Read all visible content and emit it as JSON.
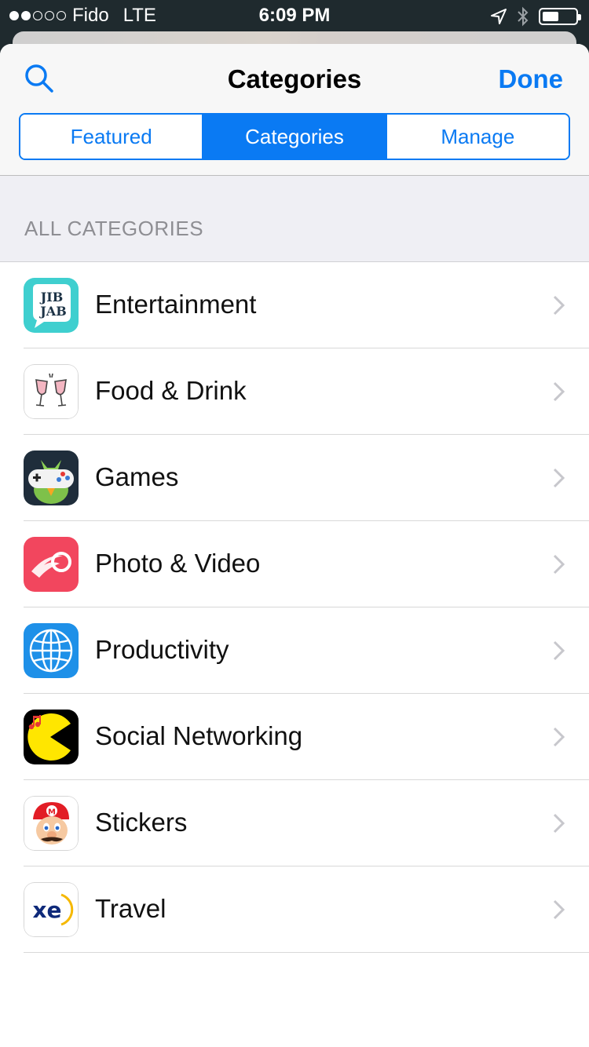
{
  "status_bar": {
    "carrier": "Fido",
    "network": "LTE",
    "time": "6:09 PM",
    "signal_bars_filled": 2,
    "signal_bars_total": 5
  },
  "nav": {
    "title": "Categories",
    "done_label": "Done"
  },
  "tabs": [
    {
      "label": "Featured",
      "active": false
    },
    {
      "label": "Categories",
      "active": true
    },
    {
      "label": "Manage",
      "active": false
    }
  ],
  "section": {
    "header": "ALL CATEGORIES"
  },
  "categories": [
    {
      "label": "Entertainment",
      "icon": "jibjab-icon"
    },
    {
      "label": "Food & Drink",
      "icon": "wine-glasses-icon"
    },
    {
      "label": "Games",
      "icon": "parrot-gamepad-icon"
    },
    {
      "label": "Photo & Video",
      "icon": "red-comet-icon"
    },
    {
      "label": "Productivity",
      "icon": "globe-icon"
    },
    {
      "label": "Social Networking",
      "icon": "pacman-icon"
    },
    {
      "label": "Stickers",
      "icon": "mario-icon"
    },
    {
      "label": "Travel",
      "icon": "xe-icon"
    }
  ],
  "icon_text": {
    "jibjab_top": "JIB",
    "jibjab_bottom": "JAB",
    "xe": "xe",
    "mario_badge": "M"
  },
  "colors": {
    "accent": "#0a7af3",
    "section_bg": "#efeff4"
  }
}
